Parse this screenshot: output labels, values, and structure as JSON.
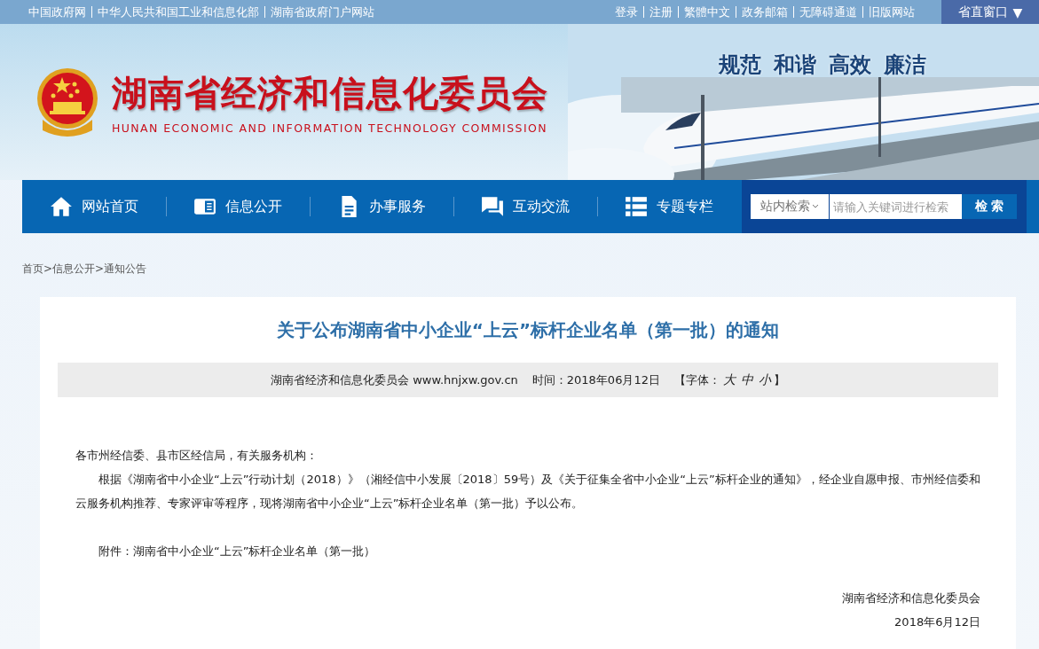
{
  "top_bar": {
    "left_links": [
      "中国政府网",
      "中华人民共和国工业和信息化部",
      "湖南省政府门户网站"
    ],
    "right_links": [
      "登录",
      "注册",
      "繁體中文",
      "政务邮箱",
      "无障碍通道",
      "旧版网站"
    ],
    "window_button": "省直窗口",
    "window_button_caret": "▼"
  },
  "header": {
    "title": "湖南省经济和信息化委员会",
    "subtitle": "HUNAN ECONOMIC AND INFORMATION TECHNOLOGY COMMISSION",
    "slogan": [
      "规范",
      "和谐",
      "高效",
      "廉洁"
    ]
  },
  "nav": {
    "items": [
      {
        "label": "网站首页",
        "kind": "home"
      },
      {
        "label": "信息公开",
        "kind": "info"
      },
      {
        "label": "办事服务",
        "kind": "doc"
      },
      {
        "label": "互动交流",
        "kind": "chat"
      },
      {
        "label": "专题专栏",
        "kind": "list"
      }
    ],
    "search": {
      "scope": "站内检索",
      "placeholder": "请输入关键词进行检索",
      "button": "检 索"
    }
  },
  "breadcrumb": "首页>信息公开>通知公告",
  "article": {
    "title": "关于公布湖南省中小企业“上云”标杆企业名单（第一批）的通知",
    "meta": {
      "source": "湖南省经济和信息化委员会 www.hnjxw.gov.cn",
      "time": "时间：2018年06月12日",
      "font_label": "【字体：",
      "font_sizes": [
        "大",
        "中",
        "小"
      ],
      "font_end": "】"
    },
    "salutation": "各市州经信委、县市区经信局，有关服务机构：",
    "body": "根据《湖南省中小企业“上云”行动计划（2018）》（湘经信中小发展〔2018〕59号）及《关于征集全省中小企业“上云”标杆企业的通知》，经企业自愿申报、市州经信委和云服务机构推荐、专家评审等程序，现将湖南省中小企业“上云”标杆企业名单（第一批）予以公布。",
    "attachment": "附件：湖南省中小企业“上云”标杆企业名单（第一批）",
    "signature": "湖南省经济和信息化委员会",
    "date": "2018年6月12日"
  }
}
